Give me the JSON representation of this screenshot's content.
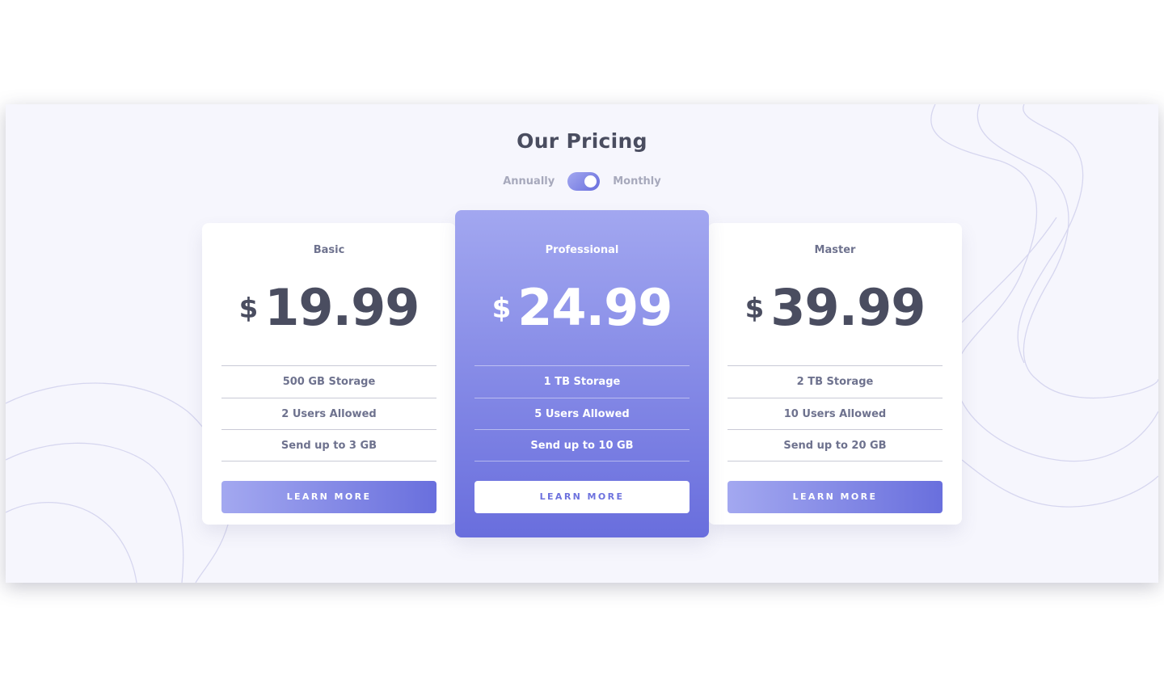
{
  "header": {
    "title": "Our Pricing",
    "toggle": {
      "left_label": "Annually",
      "right_label": "Monthly",
      "selected": "Monthly"
    }
  },
  "plans": [
    {
      "name": "Basic",
      "currency": "$",
      "price": "19.99",
      "features": [
        "500 GB Storage",
        "2 Users Allowed",
        "Send up to 3 GB"
      ],
      "button_label": "LEARN MORE"
    },
    {
      "name": "Professional",
      "currency": "$",
      "price": "24.99",
      "features": [
        "1 TB Storage",
        "5 Users Allowed",
        "Send up to 10 GB"
      ],
      "button_label": "LEARN MORE"
    },
    {
      "name": "Master",
      "currency": "$",
      "price": "39.99",
      "features": [
        "2 TB Storage",
        "10 Users Allowed",
        "Send up to 20 GB"
      ],
      "button_label": "LEARN MORE"
    }
  ],
  "colors": {
    "accent_start": "#a3a8f0",
    "accent_end": "#696fdd",
    "text_dark": "#4a4d60",
    "text_muted": "#6e728e",
    "background": "#f6f6fd"
  }
}
